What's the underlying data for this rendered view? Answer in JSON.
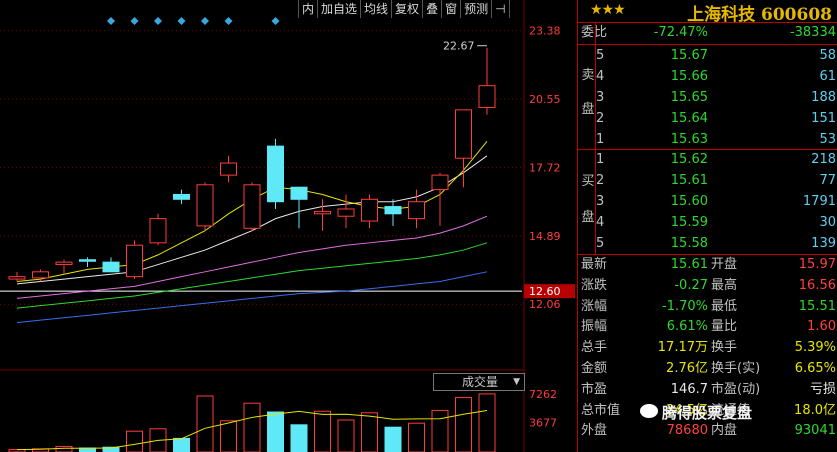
{
  "toolbar": {
    "buttons": [
      "内",
      "加自选",
      "均线",
      "复权",
      "叠",
      "窗",
      "预测"
    ],
    "pin_icon": "pin-icon"
  },
  "price_axis": {
    "ticks": [
      "23.38",
      "20.55",
      "17.72",
      "14.89",
      "12.06"
    ],
    "current_price_label": "12.60",
    "high_annotation": "22.67",
    "guide_line": 12.6,
    "ylim": [
      11.2,
      23.9
    ]
  },
  "volume_panel": {
    "label": "成交量",
    "ticks": [
      "7262",
      "3677"
    ],
    "ylim": [
      0,
      8000
    ]
  },
  "chart_data": {
    "type": "candlestick",
    "x": [
      "d1",
      "d2",
      "d3",
      "d4",
      "d5",
      "d6",
      "d7",
      "d8",
      "d9",
      "d10",
      "d11",
      "d12",
      "d13",
      "d14",
      "d15",
      "d16",
      "d17",
      "d18",
      "d19",
      "d20",
      "d21"
    ],
    "open": [
      13.1,
      13.15,
      13.7,
      13.9,
      13.8,
      13.2,
      14.6,
      16.6,
      15.3,
      17.4,
      15.2,
      18.6,
      16.9,
      15.8,
      15.7,
      15.5,
      16.1,
      15.6,
      16.8,
      18.1,
      20.2
    ],
    "high": [
      13.4,
      13.5,
      13.9,
      14.0,
      14.0,
      14.7,
      15.8,
      16.8,
      17.1,
      18.2,
      17.1,
      18.9,
      16.9,
      16.4,
      16.6,
      16.6,
      16.4,
      16.8,
      17.5,
      19.2,
      22.67
    ],
    "low": [
      13.0,
      13.0,
      13.3,
      13.6,
      13.5,
      13.1,
      14.5,
      16.2,
      15.1,
      17.1,
      15.1,
      16.0,
      15.2,
      15.1,
      15.2,
      15.2,
      15.3,
      15.2,
      15.3,
      16.9,
      19.9
    ],
    "close": [
      13.2,
      13.4,
      13.8,
      13.85,
      13.4,
      14.5,
      15.6,
      16.4,
      17.0,
      17.9,
      17.0,
      16.3,
      16.4,
      15.9,
      16.0,
      16.4,
      15.8,
      16.3,
      17.4,
      20.1,
      21.1
    ],
    "volume": [
      300,
      400,
      700,
      500,
      600,
      2600,
      2900,
      1700,
      7000,
      3900,
      6100,
      5000,
      3400,
      5100,
      4000,
      4900,
      3100,
      3600,
      5200,
      6800,
      7262
    ],
    "ma_yellow": [
      13.0,
      13.1,
      13.3,
      13.5,
      13.6,
      13.7,
      14.1,
      14.6,
      15.1,
      15.8,
      16.4,
      16.9,
      16.8,
      16.6,
      16.3,
      16.1,
      16.0,
      16.1,
      16.6,
      17.6,
      18.8
    ],
    "ma_white": [
      12.9,
      13.0,
      13.1,
      13.2,
      13.3,
      13.4,
      13.7,
      14.0,
      14.3,
      14.7,
      15.1,
      15.6,
      15.9,
      16.1,
      16.2,
      16.3,
      16.3,
      16.5,
      16.9,
      17.5,
      18.2
    ],
    "ma_magenta": [
      12.3,
      12.4,
      12.5,
      12.6,
      12.7,
      12.8,
      13.0,
      13.2,
      13.4,
      13.6,
      13.8,
      14.0,
      14.2,
      14.35,
      14.5,
      14.6,
      14.7,
      14.8,
      15.0,
      15.3,
      15.7
    ],
    "ma_green": [
      11.9,
      12.0,
      12.1,
      12.2,
      12.3,
      12.4,
      12.55,
      12.7,
      12.85,
      13.0,
      13.15,
      13.3,
      13.45,
      13.55,
      13.65,
      13.75,
      13.85,
      13.95,
      14.1,
      14.3,
      14.6
    ],
    "ma_blue": [
      11.3,
      11.4,
      11.5,
      11.6,
      11.7,
      11.8,
      11.9,
      12.0,
      12.1,
      12.2,
      12.3,
      12.4,
      12.5,
      12.55,
      12.6,
      12.7,
      12.8,
      12.9,
      13.0,
      13.2,
      13.4
    ],
    "marker_days": [
      4,
      5,
      6,
      7,
      8,
      9,
      11
    ]
  },
  "colors": {
    "up": "#ff3c3c",
    "down": "#5fe8f8",
    "bg": "#000000",
    "grid": "#7a0000",
    "accent": "#e6b800"
  },
  "stock": {
    "stars": "★★★",
    "name": "上海科技",
    "code": "600608"
  },
  "weibi": {
    "label": "委比",
    "pct": "-72.47%",
    "diff": "-38334"
  },
  "sell": {
    "side_label": [
      "卖",
      "盘"
    ],
    "rows": [
      {
        "n": "5",
        "price": "15.67",
        "vol": "58"
      },
      {
        "n": "4",
        "price": "15.66",
        "vol": "61"
      },
      {
        "n": "3",
        "price": "15.65",
        "vol": "188"
      },
      {
        "n": "2",
        "price": "15.64",
        "vol": "151"
      },
      {
        "n": "1",
        "price": "15.63",
        "vol": "53"
      }
    ]
  },
  "buy": {
    "side_label": [
      "买",
      "盘"
    ],
    "rows": [
      {
        "n": "1",
        "price": "15.62",
        "vol": "218"
      },
      {
        "n": "2",
        "price": "15.61",
        "vol": "77"
      },
      {
        "n": "3",
        "price": "15.60",
        "vol": "1791"
      },
      {
        "n": "4",
        "price": "15.59",
        "vol": "30"
      },
      {
        "n": "5",
        "price": "15.58",
        "vol": "139"
      }
    ]
  },
  "stats": [
    {
      "l1": "最新",
      "v1": "15.61",
      "c1": "green",
      "l2": "开盘",
      "v2": "15.97",
      "c2": "red"
    },
    {
      "l1": "涨跌",
      "v1": "-0.27",
      "c1": "green",
      "l2": "最高",
      "v2": "16.56",
      "c2": "red"
    },
    {
      "l1": "涨幅",
      "v1": "-1.70%",
      "c1": "green",
      "l2": "最低",
      "v2": "15.51",
      "c2": "green"
    },
    {
      "l1": "振幅",
      "v1": "6.61%",
      "c1": "green",
      "l2": "量比",
      "v2": "1.60",
      "c2": "red"
    },
    {
      "l1": "总手",
      "v1": "17.17万",
      "c1": "yellow",
      "l2": "换手",
      "v2": "5.39%",
      "c2": "yellow"
    },
    {
      "l1": "金额",
      "v1": "2.76亿",
      "c1": "yellow",
      "l2": "换手(实)",
      "v2": "6.65%",
      "c2": "yellow"
    },
    {
      "l1": "市盈",
      "v1": "146.7",
      "c1": "white",
      "l2": "市盈(动)",
      "v2": "亏损",
      "c2": "white"
    },
    {
      "l1": "总市值",
      "v1": "34.5亿",
      "c1": "yellow",
      "l2": "流通值",
      "v2": "18.0亿",
      "c2": "yellow"
    },
    {
      "l1": "外盘",
      "v1": "78680",
      "c1": "red",
      "l2": "内盘",
      "v2": "93041",
      "c2": "green"
    }
  ],
  "watermark": {
    "text": "腾得股票复盘"
  }
}
